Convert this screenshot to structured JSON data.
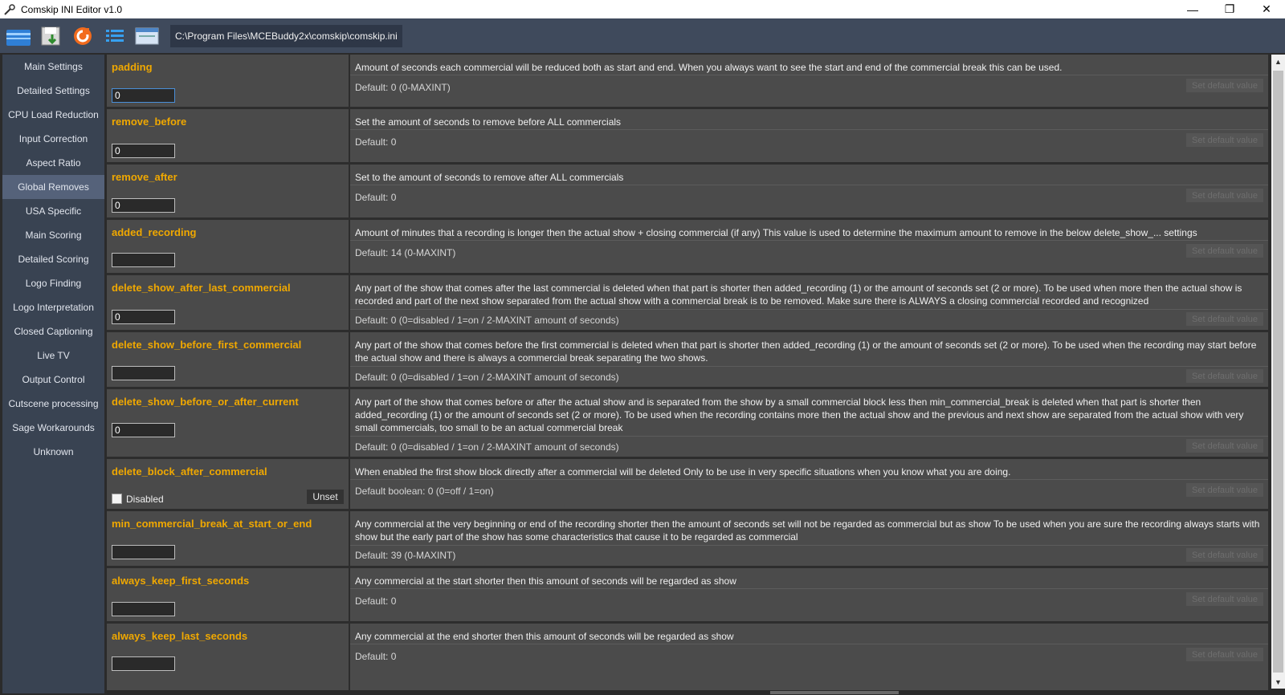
{
  "window": {
    "title": "Comskip INI Editor v1.0",
    "minimize": "—",
    "restore": "❐",
    "close": "✕"
  },
  "toolbar": {
    "path": "C:\\Program Files\\MCEBuddy2x\\comskip\\comskip.ini",
    "icons": [
      "open-icon",
      "save-icon",
      "reload-icon",
      "list-icon",
      "export-icon"
    ]
  },
  "sidebar": {
    "items": [
      {
        "label": "Main Settings"
      },
      {
        "label": "Detailed Settings"
      },
      {
        "label": "CPU Load Reduction"
      },
      {
        "label": "Input Correction"
      },
      {
        "label": "Aspect Ratio"
      },
      {
        "label": "Global Removes",
        "active": true
      },
      {
        "label": "USA Specific"
      },
      {
        "label": "Main Scoring"
      },
      {
        "label": "Detailed Scoring"
      },
      {
        "label": "Logo Finding"
      },
      {
        "label": "Logo Interpretation"
      },
      {
        "label": "Closed Captioning"
      },
      {
        "label": "Live TV"
      },
      {
        "label": "Output Control"
      },
      {
        "label": "Cutscene processing"
      },
      {
        "label": "Sage Workarounds"
      },
      {
        "label": "Unknown"
      }
    ]
  },
  "set_default_label": "Set default value",
  "params": [
    {
      "name": "padding",
      "value": "0",
      "desc": "Amount of seconds each commercial will be reduced both as start and end. When you always want to see the start and end of the commercial break this can be used.",
      "default": "Default: 0 (0-MAXINT)"
    },
    {
      "name": "remove_before",
      "value": "0",
      "desc": "Set the amount of seconds to remove before ALL commercials",
      "default": "Default: 0"
    },
    {
      "name": "remove_after",
      "value": "0",
      "desc": "Set to the amount of seconds to remove after ALL commercials",
      "default": "Default: 0"
    },
    {
      "name": "added_recording",
      "value": "",
      "desc": "Amount of minutes that a recording is longer then the actual show + closing commercial (if any) This value is used to determine the maximum amount to remove in the below delete_show_... settings",
      "default": "Default: 14 (0-MAXINT)"
    },
    {
      "name": "delete_show_after_last_commercial",
      "value": "0",
      "desc": "Any part of the show that comes after the last commercial is deleted when that part is shorter then added_recording (1) or the amount of seconds set (2 or more). To be used when more then the actual show is recorded and part of the next show separated from the actual show with a commercial break is to be removed. Make sure there is ALWAYS a closing commercial recorded and recognized",
      "default": "Default: 0 (0=disabled / 1=on / 2-MAXINT amount of seconds)"
    },
    {
      "name": "delete_show_before_first_commercial",
      "value": "",
      "desc": "Any part of the show that comes before the first commercial is deleted when that part is shorter then added_recording (1) or the amount of seconds set (2 or more). To be used when the recording may start before the actual show and there is always a commercial break separating the two shows.",
      "default": "Default: 0 (0=disabled / 1=on / 2-MAXINT amount of seconds)"
    },
    {
      "name": "delete_show_before_or_after_current",
      "value": "0",
      "desc": "Any part of the show that comes before or after the actual show and is separated from the show by a small commercial block less then min_commercial_break is deleted when that part is shorter then added_recording (1) or the amount of seconds set (2 or more). To be used when the recording contains more then the actual show and the previous and next show are separated from the actual show with very small commercials, too small to be an actual commercial break",
      "default": "Default: 0 (0=disabled / 1=on / 2-MAXINT amount of seconds)"
    },
    {
      "name": "delete_block_after_commercial",
      "checkbox_label": "Disabled",
      "unset_label": "Unset",
      "desc": "When enabled the first show block directly after a commercial will be deleted Only to be use in very specific situations when you know what you are doing.",
      "default": "Default boolean: 0 (0=off / 1=on)"
    },
    {
      "name": "min_commercial_break_at_start_or_end",
      "value": "",
      "desc": "Any commercial at the very beginning or end of the recording shorter then the amount of seconds set will not be regarded as commercial but as show To be used when you are sure the recording always starts with show but the early part of the show has some characteristics that cause it to be regarded as commercial",
      "default": "Default: 39 (0-MAXINT)"
    },
    {
      "name": "always_keep_first_seconds",
      "value": "",
      "desc": "Any commercial at the start shorter then this amount of seconds will be regarded as show",
      "default": "Default: 0"
    },
    {
      "name": "always_keep_last_seconds",
      "value": "",
      "desc": "Any commercial at the end shorter then this amount of seconds will be regarded as show",
      "default": "Default: 0"
    }
  ]
}
